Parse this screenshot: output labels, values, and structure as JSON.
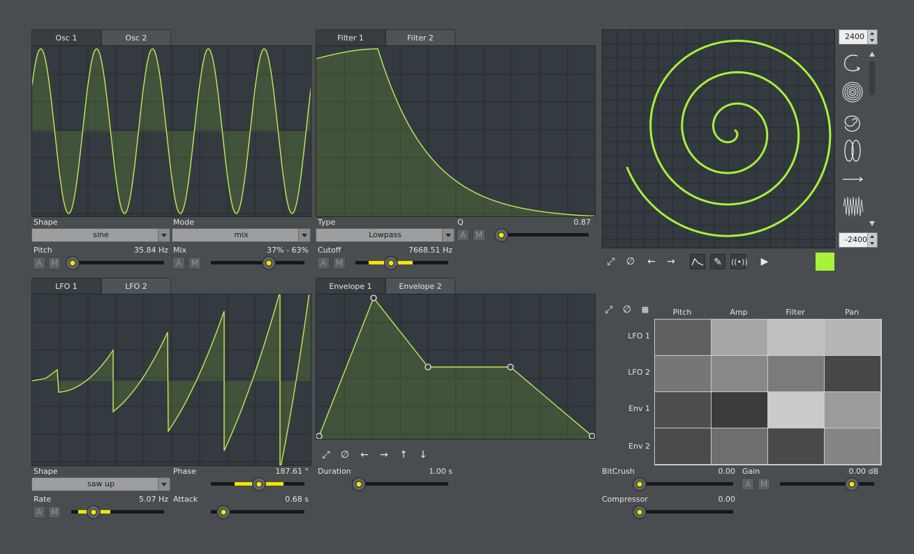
{
  "osc": {
    "tabs": [
      "Osc 1",
      "Osc 2"
    ],
    "shape_label": "Shape",
    "shape_value": "sine",
    "mode_label": "Mode",
    "mode_value": "mix",
    "pitch_label": "Pitch",
    "pitch_value": "35.84 Hz",
    "mix_label": "Mix",
    "mix_value": "37% - 63%"
  },
  "filter": {
    "tabs": [
      "Filter 1",
      "Filter 2"
    ],
    "type_label": "Type",
    "type_value": "Lowpass",
    "q_label": "Q",
    "q_value": "0.87",
    "cutoff_label": "Cutoff",
    "cutoff_value": "7668.51 Hz"
  },
  "lfo": {
    "tabs": [
      "LFO 1",
      "LFO 2"
    ],
    "shape_label": "Shape",
    "shape_value": "saw up",
    "phase_label": "Phase",
    "phase_value": "187.61 °",
    "rate_label": "Rate",
    "rate_value": "5.07 Hz",
    "attack_label": "Attack",
    "attack_value": "0.68 s"
  },
  "envelope": {
    "tabs": [
      "Envelope 1",
      "Envelope 2"
    ],
    "duration_label": "Duration",
    "duration_value": "1.00 s"
  },
  "spiral": {
    "max_value": "2400",
    "min_value": "-2400",
    "accent_color": "#a8f23a"
  },
  "matrix": {
    "columns": [
      "Pitch",
      "Amp",
      "Filter",
      "Pan"
    ],
    "rows": [
      "LFO 1",
      "LFO 2",
      "Env 1",
      "Env 2"
    ],
    "levels": [
      [
        0.3,
        0.68,
        0.82,
        0.76
      ],
      [
        0.42,
        0.52,
        0.45,
        0.17
      ],
      [
        0.2,
        0.1,
        0.88,
        0.62
      ],
      [
        0.19,
        0.38,
        0.18,
        0.5
      ]
    ]
  },
  "effects": {
    "bitcrush_label": "BitCrush",
    "bitcrush_value": "0.00",
    "gain_label": "Gain",
    "gain_value": "0.00 dB",
    "compressor_label": "Compressor",
    "compressor_value": "0.00"
  },
  "buttons": {
    "a": "A",
    "m": "M"
  },
  "colors": {
    "wave": "#c8e85a",
    "fill": "#f2e600",
    "bg": "#4a4d50"
  },
  "icons": {
    "toolbar": [
      "fit-icon",
      "reset-icon",
      "shift-left-icon",
      "shift-right-icon",
      "shift-up-icon",
      "shift-down-icon"
    ],
    "shape_presets": [
      "spiral-arc-icon",
      "spiral-dense-icon",
      "spiral-icon",
      "loops-icon",
      "line-icon",
      "noise-icon"
    ]
  }
}
